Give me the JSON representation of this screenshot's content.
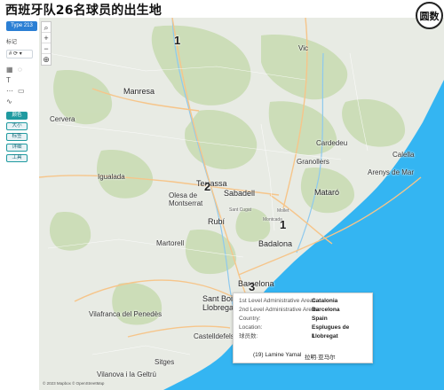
{
  "page": {
    "title": "西班牙队26名球员的出生地",
    "logo_text": "圆数"
  },
  "sidebar": {
    "tag": "Type 213",
    "section_label": "标记",
    "control_1": "# ⟳ ▾",
    "chips": [
      "颜色",
      "大小",
      "标签",
      "详细",
      "工具"
    ]
  },
  "map": {
    "colors": {
      "land": "#e8ebe4",
      "forest": "#c9dcb4",
      "sea": "#34b5f2",
      "roads": "#f6c58a"
    },
    "places": [
      {
        "id": "manresa",
        "name": "Manresa",
        "big": true
      },
      {
        "id": "terrassa",
        "name": "Terrassa",
        "big": true
      },
      {
        "id": "sabadell",
        "name": "Sabadell",
        "big": true
      },
      {
        "id": "rubi",
        "name": "Rubí",
        "big": true
      },
      {
        "id": "mataro",
        "name": "Mataró",
        "big": true
      },
      {
        "id": "badalona",
        "name": "Badalona",
        "big": true
      },
      {
        "id": "barcelona",
        "name": "Barcelona",
        "big": true
      },
      {
        "id": "santboi",
        "name": "Sant Boi de\nLlobregat",
        "big": true
      },
      {
        "id": "granollers",
        "name": "Granollers",
        "big": false
      },
      {
        "id": "igualada",
        "name": "Igualada",
        "big": false
      },
      {
        "id": "vilafranca",
        "name": "Vilafranca del Penedès",
        "big": false
      },
      {
        "id": "martorell",
        "name": "Martorell",
        "big": false
      },
      {
        "id": "sitges",
        "name": "Sitges",
        "big": false
      },
      {
        "id": "castelldefels",
        "name": "Castelldefels",
        "big": false
      },
      {
        "id": "vilanova",
        "name": "Vilanova i la Geltrú",
        "big": false
      },
      {
        "id": "olesa",
        "name": "Olesa de\nMontserrat",
        "big": false
      },
      {
        "id": "cardedeu",
        "name": "Cardedeu",
        "big": false
      },
      {
        "id": "arenys",
        "name": "Arenys de Mar",
        "big": false
      },
      {
        "id": "calella",
        "name": "Calella",
        "big": false
      },
      {
        "id": "vic",
        "name": "Vic",
        "big": false
      },
      {
        "id": "cervera",
        "name": "Cervera",
        "big": false
      },
      {
        "id": "montcada",
        "name": "Montcada",
        "big": false
      },
      {
        "id": "mollet",
        "name": "Mollet",
        "big": false
      },
      {
        "id": "sant_cugat",
        "name": "Sant Cugat",
        "big": false
      }
    ],
    "counts": [
      {
        "id": "c1",
        "value": "1"
      },
      {
        "id": "c2",
        "value": "2"
      },
      {
        "id": "c3",
        "value": "1"
      },
      {
        "id": "c4",
        "value": "3"
      }
    ],
    "attribution": "© 2023 Mapbox © OpenStreetMap"
  },
  "tooltip": {
    "rows": [
      {
        "key": "1st Level Administrative Areas:",
        "value": "Catalonia"
      },
      {
        "key": "2nd Level Administrative Areas:",
        "value": "Barcelona"
      },
      {
        "key": "Country:",
        "value": "Spain"
      },
      {
        "key": "Location:",
        "value": "Esplugues de Llobregat"
      },
      {
        "key": "球员数:",
        "value": "1"
      }
    ],
    "player_number": "(19) Lamine Yamal",
    "player_cn": "拉明·亚马尔"
  }
}
